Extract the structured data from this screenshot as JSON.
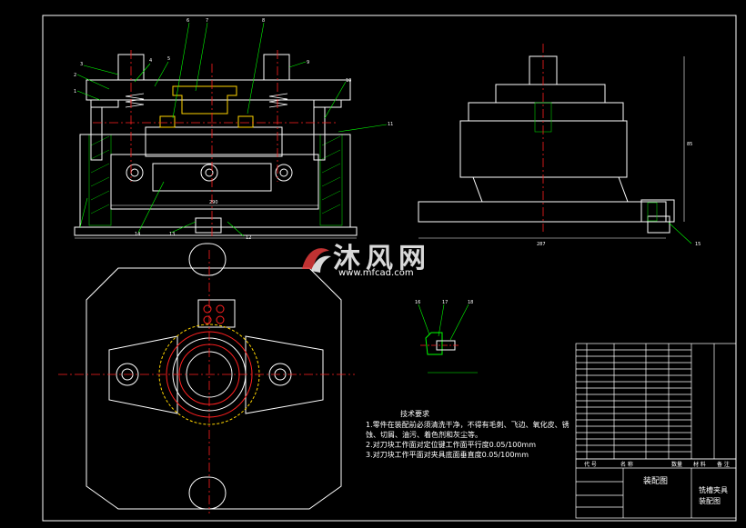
{
  "drawing": {
    "technical_requirements": {
      "title": "技术要求",
      "items": [
        "1.零件在装配前必须清洗干净，不得有毛刺、飞边、氧化皮、锈蚀、切屑、油污、着色剂和灰尘等。",
        "2.对刀块工作面对定位键工作面平行度0.05/100mm",
        "3.对刀块工作平面对夹具底面垂直度0.05/100mm"
      ]
    },
    "title_block": {
      "assembly_label": "装配图",
      "part_name": "铣槽夹具",
      "drawing_type": "装配图",
      "header_code": "代 号",
      "header_name": "名 称",
      "header_qty": "数量",
      "header_material": "材 料",
      "header_remark": "备 注"
    },
    "callouts": [
      "1",
      "2",
      "3",
      "4",
      "5",
      "6",
      "7",
      "8",
      "9",
      "10",
      "11",
      "12",
      "13",
      "14",
      "15",
      "16",
      "17",
      "18"
    ],
    "dimensions": {
      "front_width": "290",
      "side_width": "287",
      "side_height": "85"
    },
    "watermark": {
      "brand": "沐风网",
      "url": "www.mfcad.com"
    },
    "colors": {
      "background": "#000000",
      "outline": "#ffffff",
      "centerline": "#ff2020",
      "leader": "#00ff00",
      "section": "#00cc00",
      "annotation": "#ffff00"
    }
  }
}
